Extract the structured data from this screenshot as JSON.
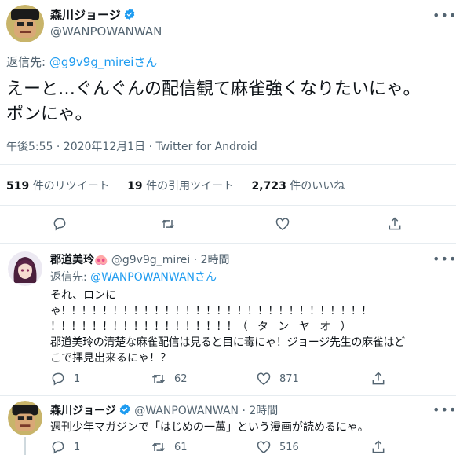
{
  "main_tweet": {
    "display_name": "森川ジョージ",
    "handle": "@WANPOWANWAN",
    "reply_prefix": "返信先:",
    "reply_to": "@g9v9g_mirei",
    "reply_suffix": "さん",
    "text_line1": "えーと…ぐんぐんの配信観て麻雀強くなりたいにゃ。",
    "text_line2": "ポンにゃ。",
    "time": "午後5:55 · 2020年12月1日 · ",
    "source": "Twitter for Android",
    "retweets_count": "519",
    "retweets_label": "件のリツイート",
    "quotes_count": "19",
    "quotes_label": "件の引用ツイート",
    "likes_count": "2,723",
    "likes_label": "件のいいね"
  },
  "reply1": {
    "display_name": "郡道美玲",
    "name_emoji": "🐽",
    "handle": "@g9v9g_mirei",
    "time": "· 2時間",
    "reply_prefix": "返信先:",
    "reply_to": "@WANPOWANWAN",
    "reply_suffix": "さん",
    "line1": "それ、ロンに",
    "line2": "ゃ！！！！！！！！！！！！！！！！！！！！！！！！！！！！！！",
    "line3": "！！！！！！！！！！！！！！！！！！（　タ　ン　ヤ　オ　）",
    "line4": "郡道美玲の清楚な麻雀配信は見ると目に毒にゃ！ジョージ先生の麻雀はど",
    "line5": "こで拝見出来るにゃ！？",
    "replies": "1",
    "retweets": "62",
    "likes": "871"
  },
  "reply2": {
    "display_name": "森川ジョージ",
    "handle": "@WANPOWANWAN",
    "time": "· 2時間",
    "line1": "週刊少年マガジンで「はじめの一萬」という漫画が読めるにゃ。",
    "replies": "1",
    "retweets": "61",
    "likes": "516"
  },
  "icons": [
    "more-icon",
    "verified-badge-icon",
    "reply-icon",
    "retweet-icon",
    "like-icon",
    "share-icon"
  ],
  "colors": {
    "link": "#1d9bf0",
    "muted": "#536471",
    "divider": "#e6ecf0"
  }
}
